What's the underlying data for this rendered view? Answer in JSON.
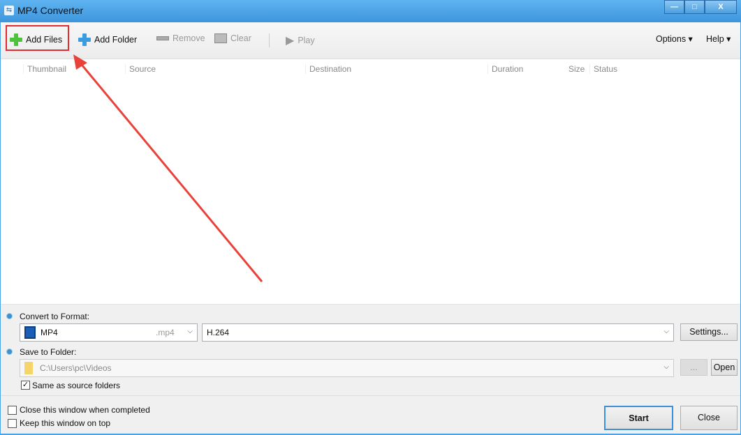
{
  "window": {
    "title": "MP4 Converter",
    "minimize": "—",
    "maximize": "□",
    "close": "X"
  },
  "toolbar": {
    "add_files": "Add Files",
    "add_folder": "Add Folder",
    "remove": "Remove",
    "clear": "Clear",
    "play": "Play",
    "options": "Options ▾",
    "help": "Help ▾"
  },
  "columns": [
    "Thumbnail",
    "Source",
    "Destination",
    "Duration",
    "Size",
    "Status"
  ],
  "format": {
    "label": "Convert to Format:",
    "value": "MP4",
    "ext": ".mp4",
    "codec": "H.264",
    "settings": "Settings..."
  },
  "folder": {
    "label": "Save to Folder:",
    "path": "C:\\Users\\pc\\Videos",
    "browse": "...",
    "open": "Open",
    "same_as_source": "Same as source folders",
    "same_checked": "✓"
  },
  "options": {
    "close_when_done": "Close this window when completed",
    "keep_on_top": "Keep this window on top"
  },
  "actions": {
    "start": "Start",
    "close": "Close"
  }
}
